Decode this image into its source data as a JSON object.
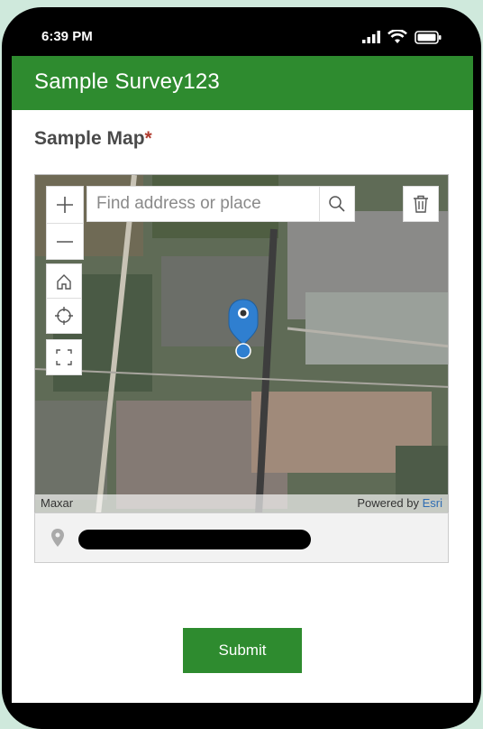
{
  "status_bar": {
    "time": "6:39 PM"
  },
  "app": {
    "title": "Sample Survey123"
  },
  "question": {
    "label": "Sample Map",
    "required_marker": "*"
  },
  "map": {
    "search_placeholder": "Find address or place",
    "attribution_left": "Maxar",
    "attribution_powered": "Powered by ",
    "attribution_esri": "Esri"
  },
  "form": {
    "submit_label": "Submit"
  },
  "colors": {
    "brand": "#2e8b2f",
    "pin": "#2f7fd0",
    "required": "#b03b2e"
  }
}
